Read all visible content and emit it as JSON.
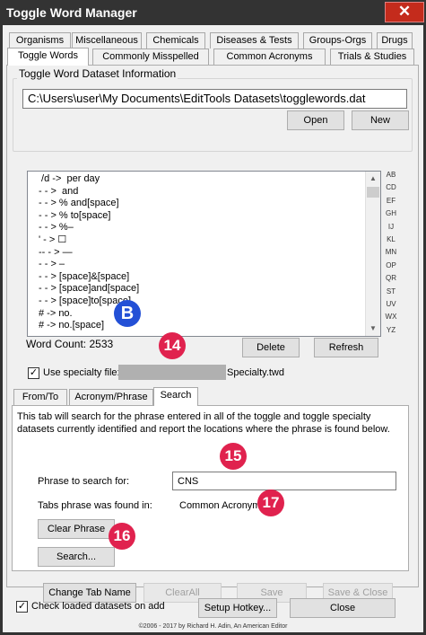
{
  "window": {
    "title": "Toggle Word Manager",
    "close_glyph": "✕"
  },
  "main_tabs_row1": [
    "Organisms",
    "Miscellaneous",
    "Chemicals",
    "Diseases & Tests",
    "Groups-Orgs",
    "Drugs"
  ],
  "main_tabs_row2": [
    "Toggle Words",
    "Commonly Misspelled",
    "Common Acronyms",
    "Trials & Studies"
  ],
  "dataset_group": {
    "label": "Toggle Word Dataset Information",
    "path": "C:\\Users\\user\\My Documents\\EditTools Datasets\\togglewords.dat",
    "open_label": "Open",
    "new_label": "New"
  },
  "word_list": {
    "items": [
      " /d ->  per day",
      "- - >  and",
      "- - > % and[space]",
      "- - > % to[space]",
      "- - > %–",
      "' - > ☐",
      "-- - > —",
      "- - > –",
      "- - > [space]&[space]",
      "- - > [space]and[space]",
      "- - > [space]to[space]",
      "# -> no.",
      "# -> no.[space]"
    ],
    "word_count_label": "Word Count: 2533",
    "delete_label": "Delete",
    "refresh_label": "Refresh",
    "alpha_index": [
      "AB",
      "CD",
      "EF",
      "GH",
      "IJ",
      "KL",
      "MN",
      "OP",
      "QR",
      "ST",
      "UV",
      "WX",
      "YZ"
    ]
  },
  "specialty": {
    "label": "Use specialty file:",
    "checked_glyph": "✓",
    "filename": "Specialty.twd"
  },
  "sub_tabs": [
    "From/To",
    "Acronym/Phrase",
    "Search"
  ],
  "search_tab": {
    "description": "This tab will search for the phrase entered in all of the toggle and toggle specialty datasets currently identified and report the locations where the phrase is found below.",
    "phrase_label": "Phrase to search for:",
    "phrase_value": "CNS",
    "found_label": "Tabs phrase was found in:",
    "found_value": "Common Acronyms",
    "clear_label": "Clear Phrase",
    "search_label": "Search..."
  },
  "bottom_buttons": {
    "change_tab_name": "Change Tab Name",
    "clear_all": "ClearAll",
    "save": "Save",
    "save_close": "Save & Close"
  },
  "footer": {
    "check_label": "Check loaded datasets on add",
    "checked_glyph": "✓",
    "setup_hotkey": "Setup Hotkey...",
    "close": "Close",
    "copyright": "©2006 - 2017 by Richard H. Adin, An American Editor"
  },
  "annotations": {
    "b": "B",
    "n14": "14",
    "n15": "15",
    "n16": "16",
    "n17": "17"
  },
  "colors": {
    "badge_red": "#e0224e",
    "badge_blue": "#2350d6",
    "titlebar": "#333333",
    "close_button": "#c42b1c"
  }
}
